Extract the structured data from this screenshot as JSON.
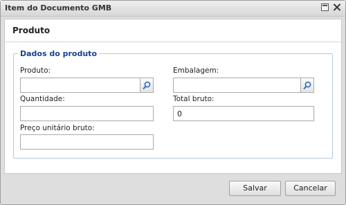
{
  "window": {
    "title": "Item do Documento GMB"
  },
  "panel": {
    "title": "Produto"
  },
  "fieldset": {
    "legend": "Dados do produto"
  },
  "fields": {
    "produto": {
      "label": "Produto:",
      "value": ""
    },
    "embalagem": {
      "label": "Embalagem:",
      "value": ""
    },
    "quantidade": {
      "label": "Quantidade:",
      "value": ""
    },
    "total_bruto": {
      "label": "Total bruto:",
      "value": "0"
    },
    "preco_unitario_bruto": {
      "label": "Preço unitário bruto:",
      "value": ""
    }
  },
  "buttons": {
    "salvar": "Salvar",
    "cancelar": "Cancelar"
  },
  "icons": {
    "lookup": "magnifier-icon",
    "maximize": "maximize-icon",
    "close": "close-icon"
  },
  "colors": {
    "legend": "#15428b",
    "lookup_icon": "#2f6db5"
  }
}
